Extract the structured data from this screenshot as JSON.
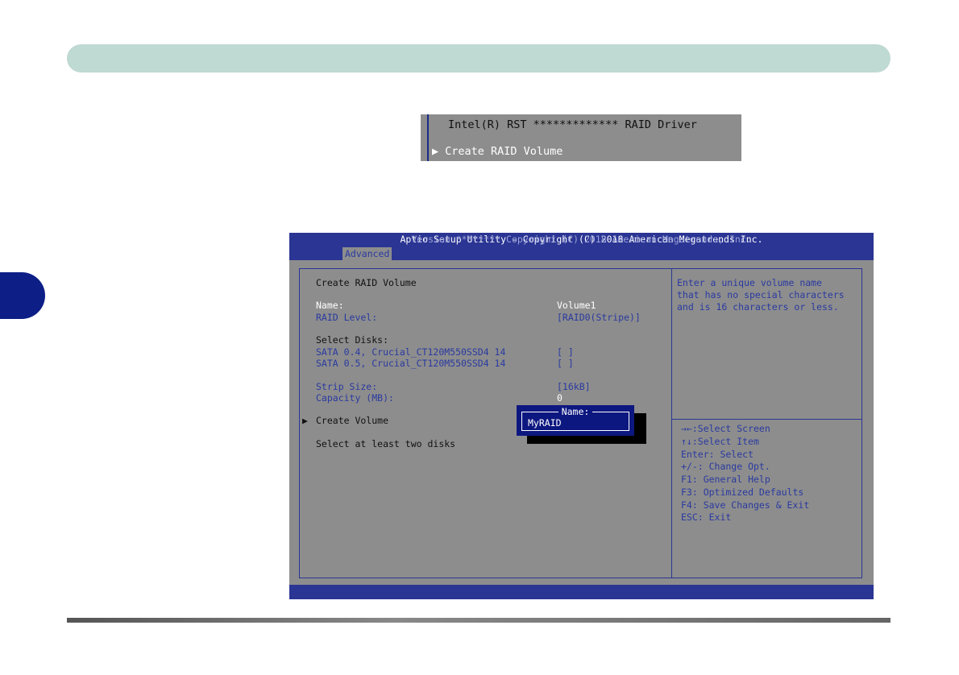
{
  "small_panel": {
    "line1": "Intel(R) RST ************* RAID Driver",
    "line2": "Create RAID Volume"
  },
  "bios": {
    "title": "Aptio Setup Utility - Copyright (C) 2018 American Megatrends Inc.",
    "tab": "Advanced",
    "heading": "Create RAID Volume",
    "name_label": "Name:",
    "name_value": "Volume1",
    "raid_level_label": "RAID Level:",
    "raid_level_value": "[RAID0(Stripe)]",
    "select_disks_label": "Select Disks:",
    "disks": [
      {
        "label": "SATA 0.4, Crucial_CT120M550SSD4 14",
        "value": "[ ]"
      },
      {
        "label": "SATA 0.5, Crucial_CT120M550SSD4 14",
        "value": "[ ]"
      }
    ],
    "strip_size_label": "Strip Size:",
    "strip_size_value": "[16kB]",
    "capacity_label": "Capacity (MB):",
    "capacity_value": "0",
    "create_volume": "Create Volume",
    "hint": "Select at least two disks",
    "help_lines": [
      "Enter a unique volume name",
      "that has no special characters",
      "and is 16 characters or less."
    ],
    "keys": [
      "→←:Select Screen",
      "↑↓:Select Item",
      "Enter: Select",
      "+/-: Change Opt.",
      "F1: General Help",
      "F3: Optimized Defaults",
      "F4: Save Changes & Exit",
      "ESC: Exit"
    ],
    "footer": "Version ******** Copyright (C) 2018 American Megatrends, Inc.",
    "popup": {
      "title": "Name:",
      "value": "MyRAID"
    }
  },
  "colors": {
    "header_bar": "#bfd9d3",
    "side_tab": "#0d1f87",
    "bios_bg": "#8d8d8d",
    "bios_blue": "#2b3594"
  }
}
